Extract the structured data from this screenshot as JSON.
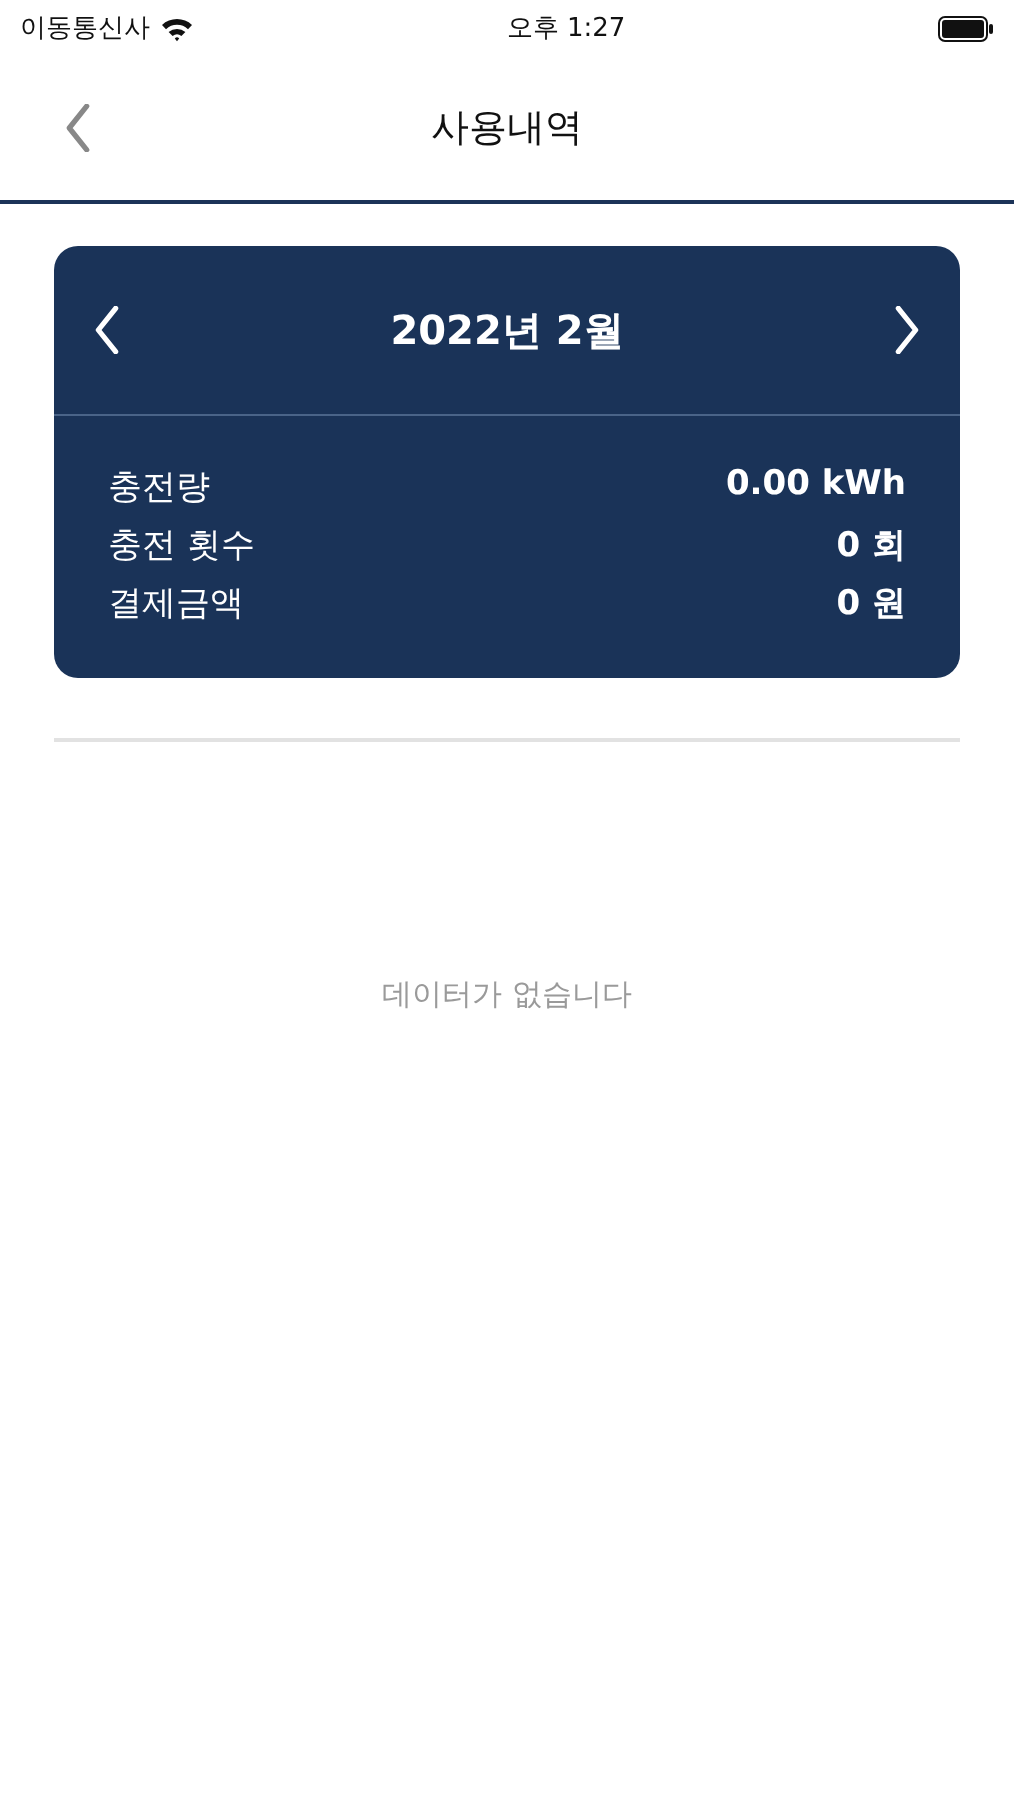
{
  "status_bar": {
    "carrier": "이동통신사",
    "time": "오후 1:27"
  },
  "nav": {
    "title": "사용내역"
  },
  "summary": {
    "month": "2022년 2월",
    "rows": [
      {
        "label": "충전량",
        "value": "0.00 kWh"
      },
      {
        "label": "충전 횟수",
        "value": "0 회"
      },
      {
        "label": "결제금액",
        "value": "0 원"
      }
    ]
  },
  "empty_message": "데이터가 없습니다"
}
